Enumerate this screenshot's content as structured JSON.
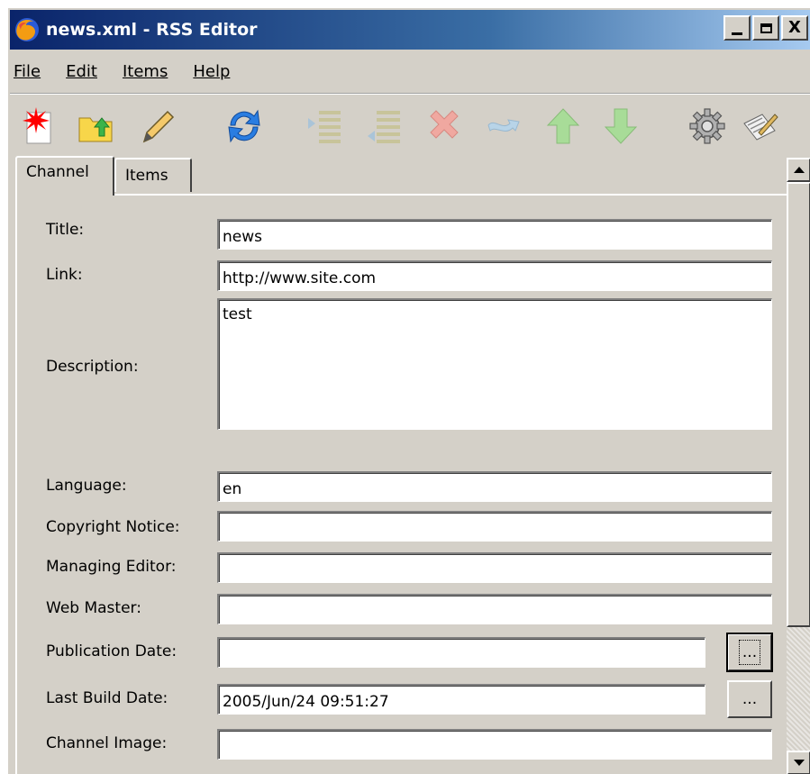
{
  "window": {
    "title": "news.xml - RSS Editor",
    "controls": {
      "minimize": "_",
      "maximize": "□",
      "close": "X"
    }
  },
  "menu": [
    "File",
    "Edit",
    "Items",
    "Help"
  ],
  "toolbar": {
    "icons": [
      "new-file-icon",
      "open-folder-icon",
      "edit-pencil-icon",
      "refresh-icon",
      "indent-icon",
      "outdent-icon",
      "delete-icon",
      "undo-icon",
      "move-up-icon",
      "move-down-icon",
      "settings-gear-icon",
      "publish-icon"
    ],
    "disabled": [
      "indent-icon",
      "outdent-icon",
      "delete-icon",
      "undo-icon",
      "move-up-icon",
      "move-down-icon"
    ]
  },
  "tabs": [
    {
      "label": "Channel",
      "active": true
    },
    {
      "label": "Items",
      "active": false
    }
  ],
  "channel": {
    "title": {
      "label": "Title:",
      "value": "news"
    },
    "link": {
      "label": "Link:",
      "value": "http://www.site.com"
    },
    "description": {
      "label": "Description:",
      "value": "test"
    },
    "language": {
      "label": "Language:",
      "value": "en"
    },
    "copyright": {
      "label": "Copyright Notice:",
      "value": ""
    },
    "managing_editor": {
      "label": "Managing Editor:",
      "value": ""
    },
    "web_master": {
      "label": "Web Master:",
      "value": ""
    },
    "publication_date": {
      "label": "Publication Date:",
      "value": "",
      "button": "..."
    },
    "last_build_date": {
      "label": "Last Build Date:",
      "value": "2005/Jun/24 09:51:27",
      "button": "..."
    },
    "channel_image": {
      "label": "Channel Image:",
      "value": ""
    }
  },
  "colors": {
    "titlebar_start": "#0a246a",
    "titlebar_end": "#a6caf0",
    "window_bg": "#d4d0c8"
  }
}
